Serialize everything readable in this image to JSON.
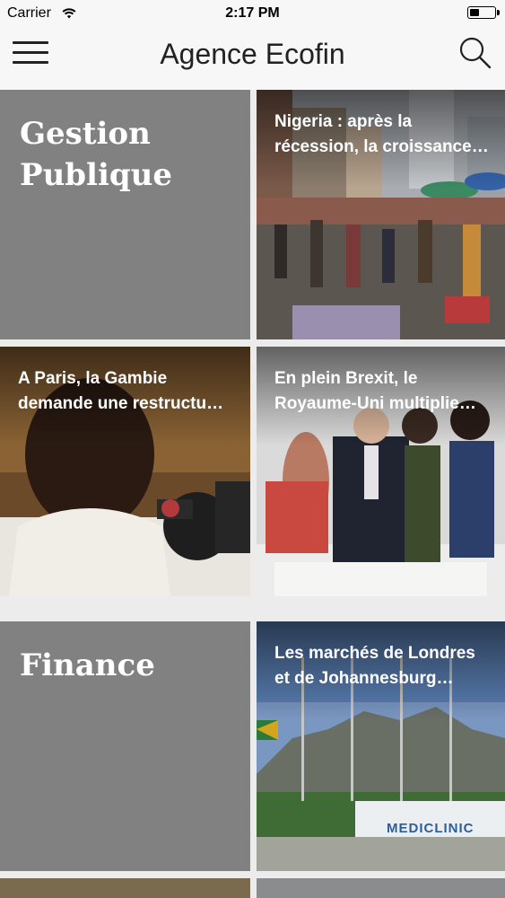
{
  "status_bar": {
    "carrier": "Carrier",
    "time": "2:17 PM"
  },
  "nav_bar": {
    "title": "Agence Ecofin",
    "menu_icon": "hamburger-menu-icon",
    "search_icon": "search-icon"
  },
  "sections": [
    {
      "title": "Gestion Publique",
      "articles": [
        {
          "headline": "Nigeria : après la récession, la croissance…",
          "photo": "market-crowd-photo"
        },
        {
          "headline": "A Paris, la Gambie demande une restructu…",
          "photo": "gambian-official-photo"
        },
        {
          "headline": "En plein Brexit, le Royaume-Uni multiplie…",
          "photo": "reception-group-photo"
        }
      ]
    },
    {
      "title": "Finance",
      "articles": [
        {
          "headline": "Les marchés de Londres et de Johannesburg déçus…",
          "photo": "mediclinic-building-photo",
          "sign_text": "MEDICLINIC"
        }
      ]
    }
  ],
  "colors": {
    "section_tile": "#818182",
    "bar_background": "#f7f7f7",
    "page_background": "#ececec"
  }
}
